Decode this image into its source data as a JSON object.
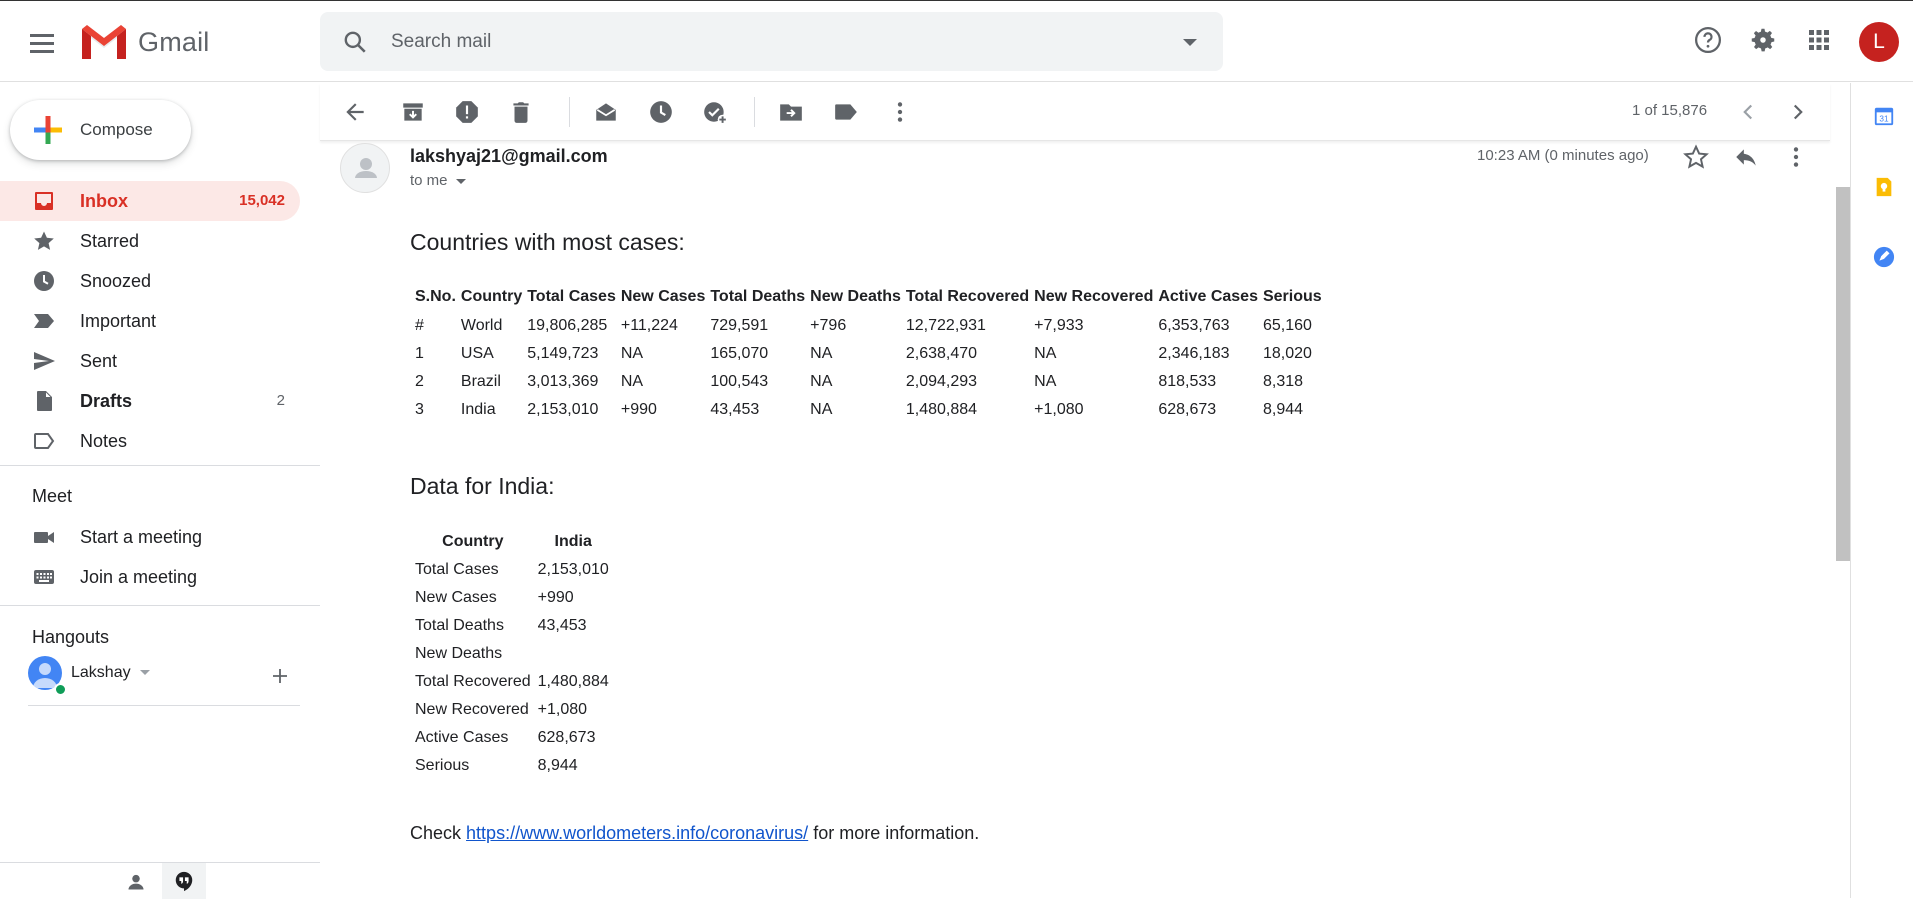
{
  "app": {
    "name": "Gmail"
  },
  "search": {
    "placeholder": "Search mail"
  },
  "account": {
    "initial": "L"
  },
  "compose": {
    "label": "Compose"
  },
  "nav": [
    {
      "label": "Inbox",
      "count": "15,042"
    },
    {
      "label": "Starred",
      "count": ""
    },
    {
      "label": "Snoozed",
      "count": ""
    },
    {
      "label": "Important",
      "count": ""
    },
    {
      "label": "Sent",
      "count": ""
    },
    {
      "label": "Drafts",
      "count": "2"
    },
    {
      "label": "Notes",
      "count": ""
    }
  ],
  "meet": {
    "title": "Meet",
    "start": "Start a meeting",
    "join": "Join a meeting"
  },
  "hangouts": {
    "title": "Hangouts",
    "user": "Lakshay"
  },
  "pager": {
    "text": "1 of 15,876"
  },
  "message": {
    "sender": "lakshyaj21@gmail.com",
    "recipient": "to me",
    "time": "10:23 AM (0 minutes ago)",
    "heading1": "Countries with most cases:",
    "heading2": "Data for India:",
    "check_prefix": "Check",
    "link": "https://www.worldometers.info/coronavirus/",
    "check_suffix": "for more information."
  },
  "cases_table": {
    "headers": [
      "S.No.",
      "Country",
      "Total Cases",
      "New Cases",
      "Total Deaths",
      "New Deaths",
      "Total Recovered",
      "New Recovered",
      "Active Cases",
      "Serious"
    ],
    "rows": [
      [
        "#",
        "World",
        "19,806,285",
        "+11,224",
        "729,591",
        "+796",
        "12,722,931",
        "+7,933",
        "6,353,763",
        "65,160"
      ],
      [
        "1",
        "USA",
        "5,149,723",
        "NA",
        "165,070",
        "NA",
        "2,638,470",
        "NA",
        "2,346,183",
        "18,020"
      ],
      [
        "2",
        "Brazil",
        "3,013,369",
        "NA",
        "100,543",
        "NA",
        "2,094,293",
        "NA",
        "818,533",
        "8,318"
      ],
      [
        "3",
        "India",
        "2,153,010",
        "+990",
        "43,453",
        "NA",
        "1,480,884",
        "+1,080",
        "628,673",
        "8,944"
      ]
    ]
  },
  "india_table": {
    "headers": [
      "Country",
      "India"
    ],
    "rows": [
      [
        "Total Cases",
        "2,153,010"
      ],
      [
        "New Cases",
        "+990"
      ],
      [
        "Total Deaths",
        "43,453"
      ],
      [
        "New Deaths",
        ""
      ],
      [
        "Total Recovered",
        "1,480,884"
      ],
      [
        "New Recovered",
        "+1,080"
      ],
      [
        "Active Cases",
        "628,673"
      ],
      [
        "Serious",
        "8,944"
      ]
    ]
  },
  "colors": {
    "accent_red": "#d93025",
    "inbox_bg": "#fce8e6",
    "link": "#1155cc",
    "avatar_red": "#c5221f"
  }
}
